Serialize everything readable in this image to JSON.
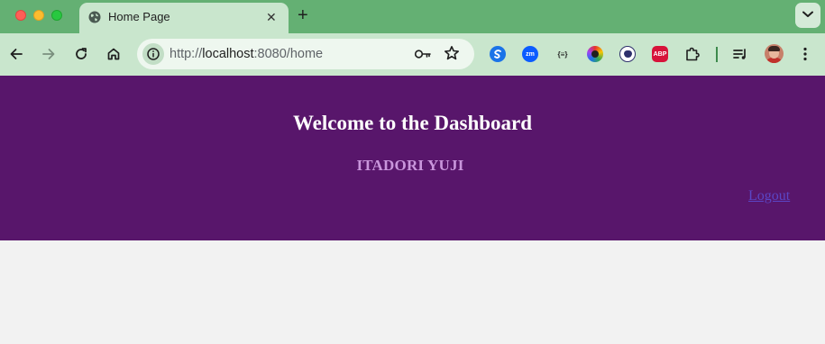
{
  "browser": {
    "tab": {
      "title": "Home Page",
      "icon": "globe-icon",
      "close_icon": "close-icon"
    },
    "new_tab_icon": "plus-icon",
    "tab_search_icon": "chevron-down-icon",
    "toolbar": {
      "back_icon": "arrow-left-icon",
      "forward_icon": "arrow-right-icon",
      "reload_icon": "reload-icon",
      "home_icon": "home-icon",
      "site_info_icon": "info-icon",
      "url": {
        "scheme": "http://",
        "host": "localhost",
        "rest": ":8080/home"
      },
      "password_icon": "key-icon",
      "bookmark_icon": "star-icon"
    },
    "extensions": [
      {
        "name": "extension-s-icon",
        "label": "",
        "color": "#1a73e8"
      },
      {
        "name": "extension-zoom-icon",
        "label": "zm",
        "color": "#0b5cff"
      },
      {
        "name": "extension-json-icon",
        "label": "{≡}",
        "color": "#1f1f1f"
      },
      {
        "name": "extension-color-wheel-icon",
        "label": "",
        "color": "#e5322d"
      },
      {
        "name": "extension-cat-icon",
        "label": "",
        "color": "#2d2f6b"
      },
      {
        "name": "extension-adblock-icon",
        "label": "ABP",
        "color": "#d7133a"
      },
      {
        "name": "extensions-puzzle-icon",
        "label": "",
        "color": "#1f1f1f"
      }
    ],
    "reading_list_icon": "reading-list-icon",
    "profile_icon": "avatar",
    "menu_icon": "more-vertical-icon"
  },
  "page": {
    "header_bg": "#58166b",
    "heading": "Welcome to the Dashboard",
    "username": "ITADORI YUJI",
    "logout_label": "Logout"
  }
}
